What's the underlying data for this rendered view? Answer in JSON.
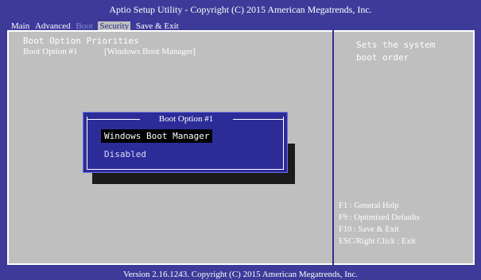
{
  "window": {
    "title": "Aptio Setup Utility - Copyright (C) 2015 American Megatrends, Inc.",
    "footer": "Version 2.16.1243. Copyright (C) 2015 American Megatrends, Inc."
  },
  "tabs": [
    {
      "label": "Main"
    },
    {
      "label": "Advanced"
    },
    {
      "label": "Boot"
    },
    {
      "label": "Security"
    },
    {
      "label": "Save & Exit"
    }
  ],
  "left": {
    "section_title": "Boot Option Priorities",
    "option_label": "Boot Option #1",
    "option_value": "[Windows Boot Manager]"
  },
  "right": {
    "help_lines": [
      "Sets the system",
      "boot order"
    ],
    "keys": [
      "F1   : General Help",
      "F9   : Optimized Defaults",
      "F10  : Save & Exit",
      "ESC/Right Click  : Exit"
    ]
  },
  "popup": {
    "title": "Boot Option #1",
    "items": [
      "Windows Boot Manager",
      "Disabled"
    ],
    "selected_index": 0
  },
  "colors": {
    "background": "#3d3a9a",
    "panel": "#bfbfbf",
    "accent": "#2f2f8f",
    "popup": "#2c2c99"
  }
}
